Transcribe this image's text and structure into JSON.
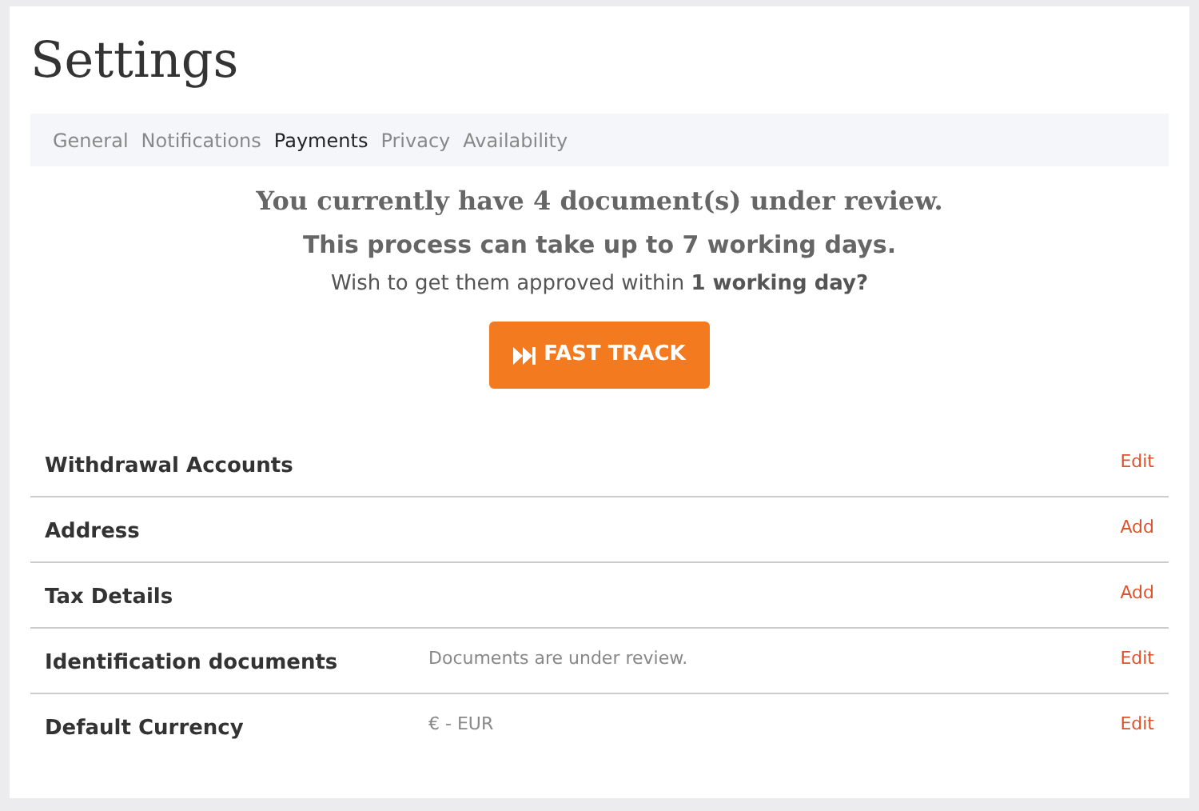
{
  "title": "Settings",
  "tabs": [
    {
      "label": "General",
      "selected": false
    },
    {
      "label": "Notifications",
      "selected": false
    },
    {
      "label": "Payments",
      "selected": true
    },
    {
      "label": "Privacy",
      "selected": false
    },
    {
      "label": "Availability",
      "selected": false
    }
  ],
  "notice": {
    "headline": "You currently have 4 document(s) under review.",
    "subline": "This process can take up to 7 working days.",
    "question": "Wish to get them approved within **1 working day?**",
    "button": "FAST TRACK"
  },
  "rows": [
    {
      "label": "Withdrawal Accounts",
      "action": "Edit"
    },
    {
      "label": "Address",
      "action": "Add"
    },
    {
      "label": "Tax Details",
      "action": "Add"
    },
    {
      "label": "Identification documents",
      "value": "Documents are under review.",
      "action": "Edit"
    },
    {
      "label": "Default Currency",
      "value": "€ - EUR",
      "action": "Edit"
    }
  ]
}
